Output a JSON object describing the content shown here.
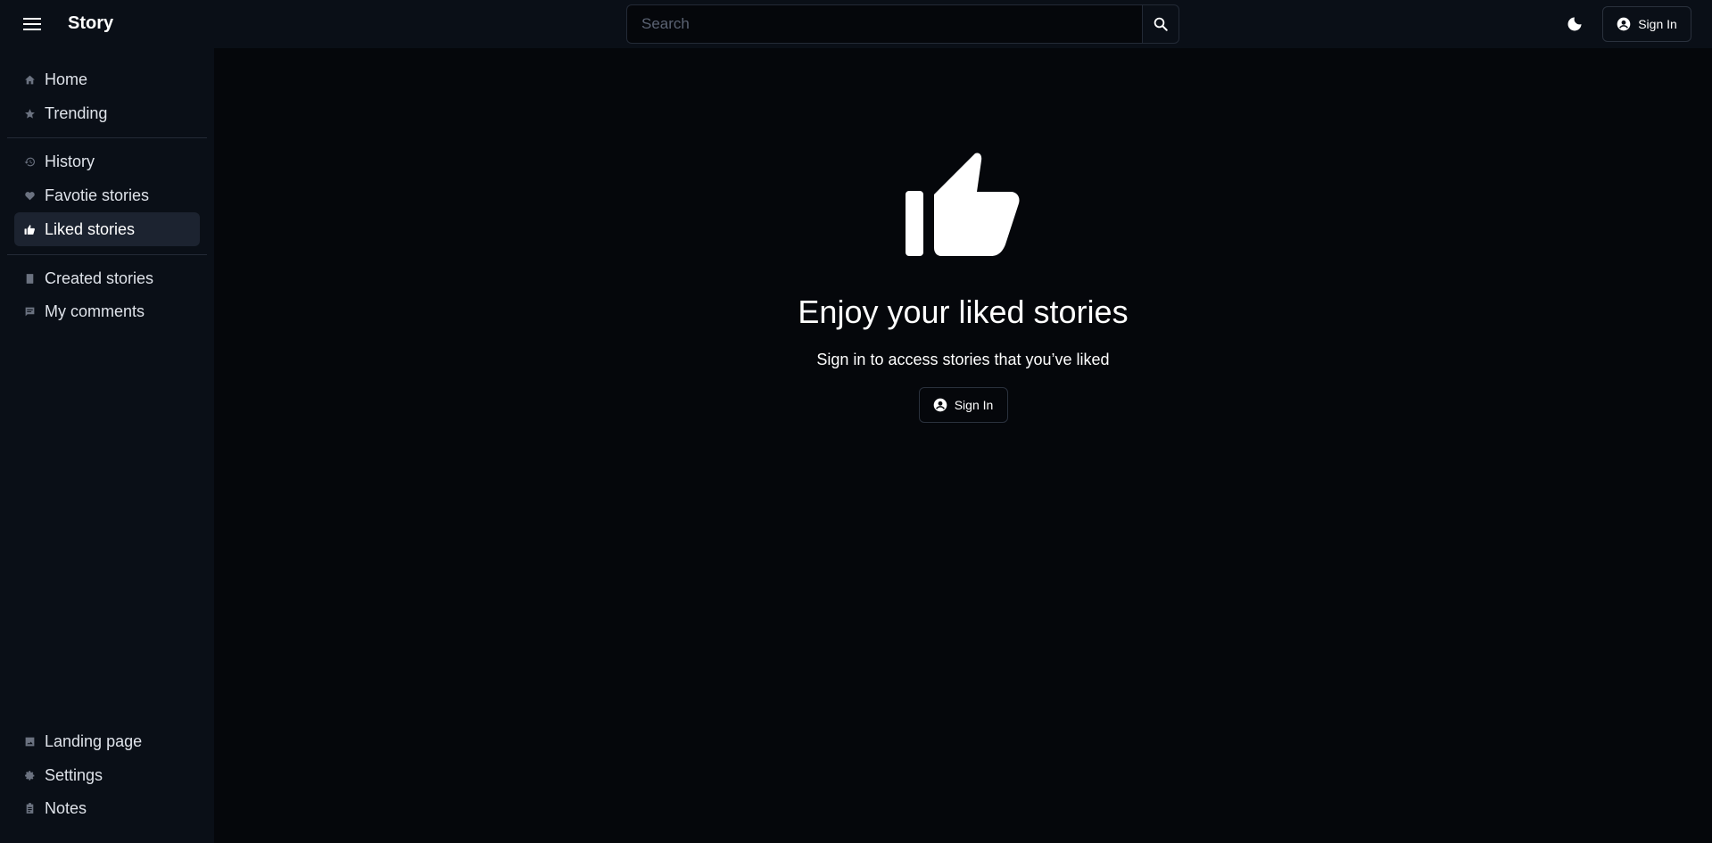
{
  "header": {
    "brand": "Story",
    "menu_icon": "hamburger-menu-icon",
    "search_placeholder": "Search",
    "search_value": "",
    "search_icon": "search-icon",
    "theme_icon": "moon-icon",
    "signin_label": "Sign In",
    "signin_icon": "account-circle-icon"
  },
  "sidebar": {
    "group1": [
      {
        "label": "Home",
        "icon": "home-icon"
      },
      {
        "label": "Trending",
        "icon": "star-icon"
      }
    ],
    "group2": [
      {
        "label": "History",
        "icon": "history-icon"
      },
      {
        "label": "Favotie stories",
        "icon": "heart-icon"
      },
      {
        "label": "Liked stories",
        "icon": "thumb-up-icon",
        "active": true
      }
    ],
    "group3": [
      {
        "label": "Created stories",
        "icon": "book-icon"
      },
      {
        "label": "My comments",
        "icon": "comment-icon"
      }
    ],
    "bottom": [
      {
        "label": "Landing page",
        "icon": "image-icon"
      },
      {
        "label": "Settings",
        "icon": "gear-icon"
      },
      {
        "label": "Notes",
        "icon": "clipboard-icon"
      }
    ]
  },
  "main": {
    "hero_icon": "thumb-up-icon",
    "title": "Enjoy your liked stories",
    "subtitle": "Sign in to access stories that you’ve liked",
    "signin_label": "Sign In",
    "signin_icon": "account-circle-icon"
  },
  "colors": {
    "background": "#05070b",
    "sidebar": "#0a0f17",
    "active_item": "#1c2330",
    "border": "#232a36"
  }
}
